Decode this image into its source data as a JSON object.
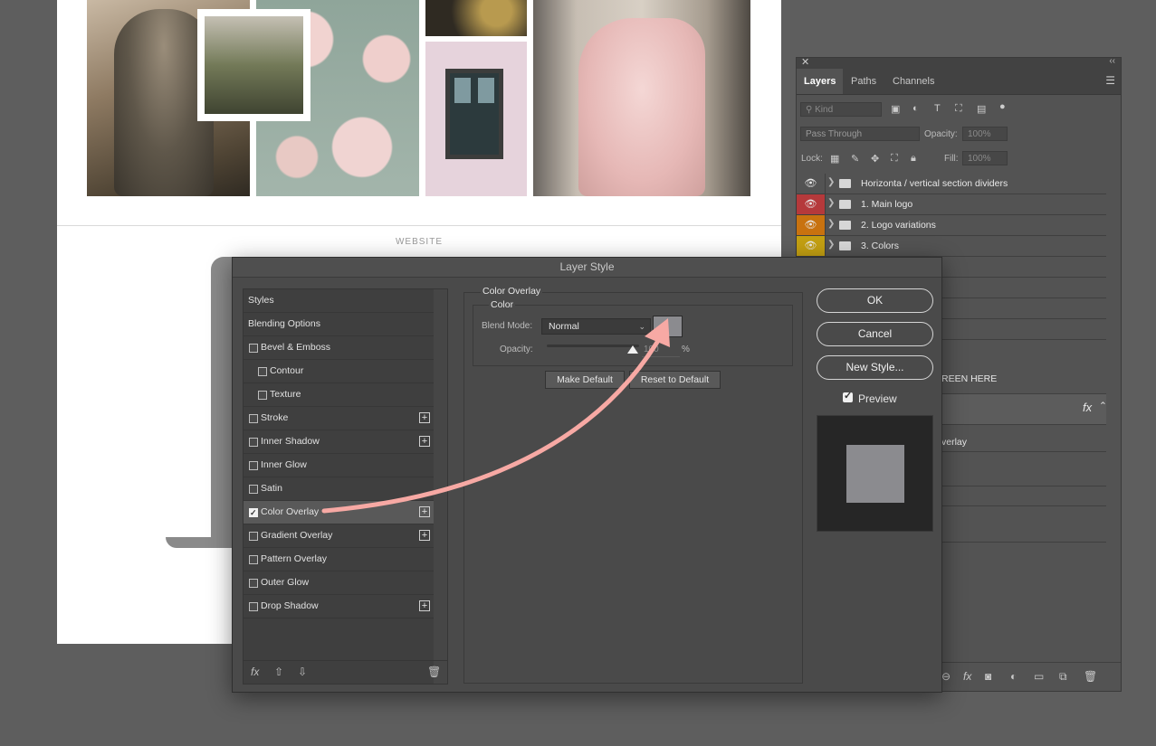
{
  "canvas": {
    "section_label": "WEBSITE"
  },
  "layers_panel": {
    "tabs": [
      "Layers",
      "Paths",
      "Channels"
    ],
    "kind_placeholder": "Kind",
    "blend_mode": "Pass Through",
    "opacity_label": "Opacity:",
    "opacity_value": "100%",
    "lock_label": "Lock:",
    "fill_label": "Fill:",
    "fill_value": "100%",
    "layers": [
      {
        "name": "Horizonta / vertical section dividers",
        "eye_color": "#535353"
      },
      {
        "name": "1. Main logo",
        "eye_color": "#b5393b"
      },
      {
        "name": "2. Logo variations",
        "eye_color": "#c8720f"
      },
      {
        "name": "3. Colors",
        "eye_color": "#c4a012"
      }
    ],
    "partial_text_1": "REEN HERE",
    "partial_text_2": "fx",
    "partial_text_3": "verlay"
  },
  "dialog": {
    "title": "Layer Style",
    "styles": [
      {
        "label": "Styles",
        "type": "header"
      },
      {
        "label": "Blending Options",
        "type": "header"
      },
      {
        "label": "Bevel & Emboss",
        "type": "check",
        "checked": false,
        "indent": false,
        "plus": false
      },
      {
        "label": "Contour",
        "type": "check",
        "checked": false,
        "indent": true,
        "plus": false
      },
      {
        "label": "Texture",
        "type": "check",
        "checked": false,
        "indent": true,
        "plus": false
      },
      {
        "label": "Stroke",
        "type": "check",
        "checked": false,
        "indent": false,
        "plus": true
      },
      {
        "label": "Inner Shadow",
        "type": "check",
        "checked": false,
        "indent": false,
        "plus": true
      },
      {
        "label": "Inner Glow",
        "type": "check",
        "checked": false,
        "indent": false,
        "plus": false
      },
      {
        "label": "Satin",
        "type": "check",
        "checked": false,
        "indent": false,
        "plus": false
      },
      {
        "label": "Color Overlay",
        "type": "check",
        "checked": true,
        "indent": false,
        "plus": true,
        "selected": true
      },
      {
        "label": "Gradient Overlay",
        "type": "check",
        "checked": false,
        "indent": false,
        "plus": true
      },
      {
        "label": "Pattern Overlay",
        "type": "check",
        "checked": false,
        "indent": false,
        "plus": false
      },
      {
        "label": "Outer Glow",
        "type": "check",
        "checked": false,
        "indent": false,
        "plus": false
      },
      {
        "label": "Drop Shadow",
        "type": "check",
        "checked": false,
        "indent": false,
        "plus": true
      }
    ],
    "section_title": "Color Overlay",
    "group_title": "Color",
    "blend_mode_label": "Blend Mode:",
    "blend_mode_value": "Normal",
    "overlay_color": "#8b8b8f",
    "opacity_label": "Opacity:",
    "opacity_value": "100",
    "opacity_unit": "%",
    "make_default": "Make Default",
    "reset_default": "Reset to Default",
    "ok": "OK",
    "cancel": "Cancel",
    "new_style": "New Style...",
    "preview_label": "Preview",
    "preview_checked": true,
    "annotation_arrow_color": "#f7a9a4"
  }
}
